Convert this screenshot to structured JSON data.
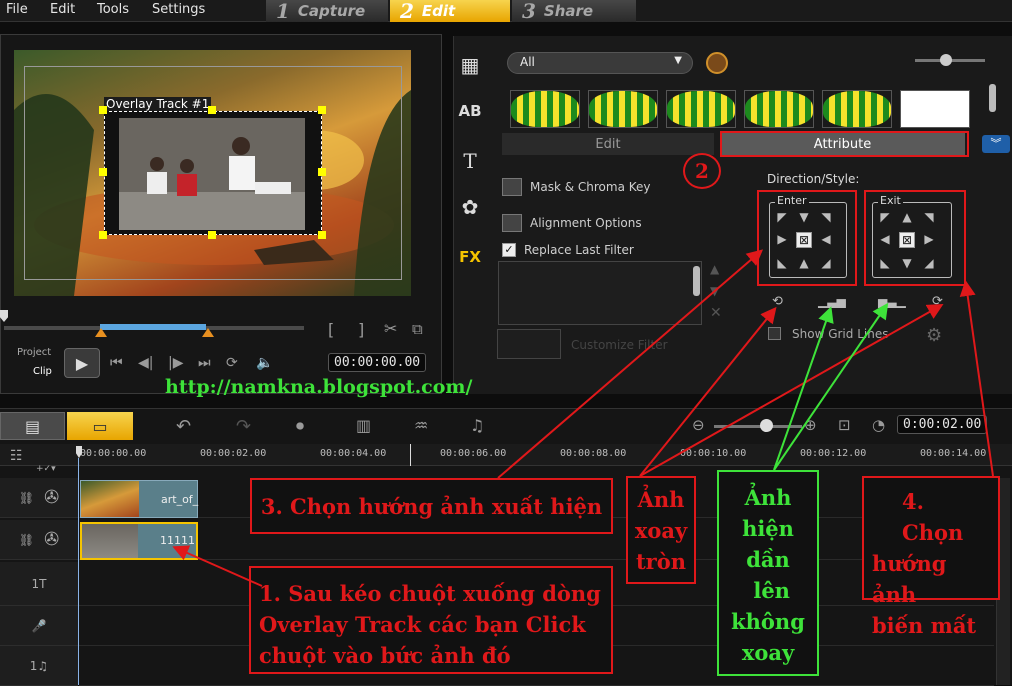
{
  "menu": [
    "File",
    "Edit",
    "Tools",
    "Settings"
  ],
  "steps": [
    {
      "num": "1",
      "label": "Capture"
    },
    {
      "num": "2",
      "label": "Edit"
    },
    {
      "num": "3",
      "label": "Share"
    }
  ],
  "preview": {
    "overlay_label": "Overlay Track #1",
    "project_label": "Project",
    "clip_label": "Clip",
    "timecode": "00:00:00.00",
    "bracket_in": "[",
    "bracket_out": "]"
  },
  "library": {
    "filter_select": "All",
    "tabs": {
      "edit": "Edit",
      "attribute": "Attribute"
    },
    "options": {
      "mask": "Mask & Chroma Key",
      "alignment": "Alignment Options",
      "replace_filter": "Replace Last Filter",
      "customize_filter": "Customize Filter",
      "show_grid": "Show Grid Lines"
    },
    "direction_label": "Direction/Style:",
    "enter_label": "Enter",
    "exit_label": "Exit"
  },
  "url": "http://namkna.blogspot.com/",
  "timeline": {
    "timecode": "0:00:02.00",
    "ruler": [
      "00:00:00.00",
      "00:00:02.00",
      "00:00:04.00",
      "00:00:06.00",
      "00:00:08.00",
      "00:00:10.00",
      "00:00:12.00",
      "00:00:14.00"
    ],
    "clip1_label": "art_of_",
    "clip2_label": "11111",
    "track_title": "1T",
    "track_music": "1♫"
  },
  "annotations": {
    "circle_num": "2",
    "a1": [
      "1. Sau kéo chuột xuống dòng",
      "Overlay Track  các bạn Click",
      "chuột vào bức ảnh đó"
    ],
    "a3": "3. Chọn hướng ảnh xuất hiện",
    "a4": [
      "4. Chọn",
      "hướng ảnh",
      "biến mất"
    ],
    "rotate": [
      "Ảnh",
      "xoay",
      "tròn"
    ],
    "fade": [
      "Ảnh",
      "hiện",
      "dần",
      " lên",
      "không",
      "xoay"
    ]
  },
  "colors": {
    "accent": "#e8a500",
    "red": "#e0181a",
    "green": "#3ee33a",
    "url": "#3ee33a"
  }
}
